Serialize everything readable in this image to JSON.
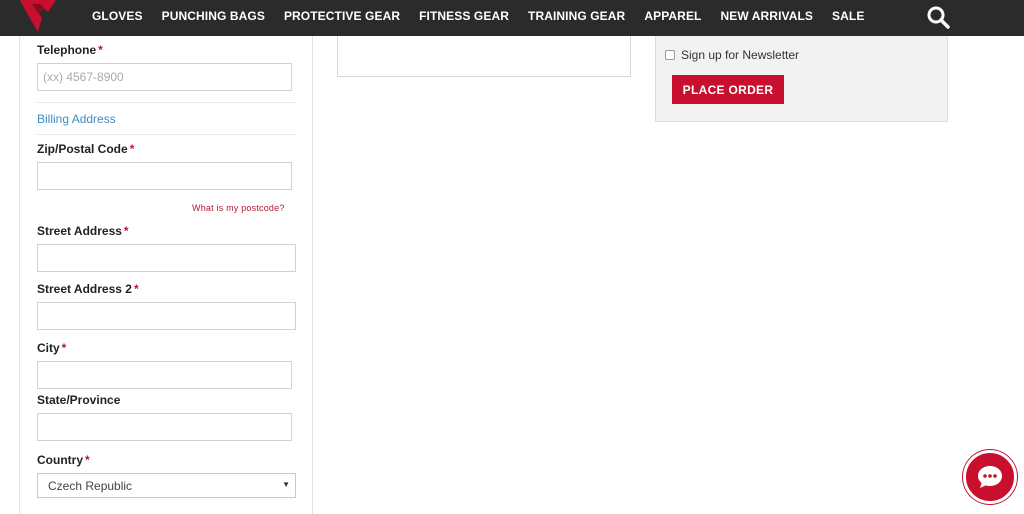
{
  "nav": {
    "items": [
      "GLOVES",
      "PUNCHING BAGS",
      "PROTECTIVE GEAR",
      "FITNESS GEAR",
      "TRAINING GEAR",
      "APPAREL",
      "NEW ARRIVALS",
      "SALE"
    ]
  },
  "icons": {
    "logo": "brand-logo-icon",
    "search": "search-icon",
    "chat": "chat-bubble-icon"
  },
  "colors": {
    "accent": "#c8102e",
    "topbar": "#2b2b2b",
    "link": "#3d8fc4"
  },
  "billing": {
    "telephone": {
      "label": "Telephone",
      "required": "*",
      "placeholder": "(xx) 4567-8900",
      "value": ""
    },
    "section_link": "Billing Address",
    "zip": {
      "label": "Zip/Postal Code",
      "required": "*",
      "value": ""
    },
    "postcode_help": "What is my postcode?",
    "street1": {
      "label": "Street Address",
      "required": "*",
      "value": ""
    },
    "street2": {
      "label": "Street Address 2",
      "required": "*",
      "value": ""
    },
    "city": {
      "label": "City",
      "required": "*",
      "value": ""
    },
    "state": {
      "label": "State/Province",
      "value": ""
    },
    "country": {
      "label": "Country",
      "required": "*",
      "selected": "Czech Republic",
      "caret": "▼"
    }
  },
  "summary": {
    "newsletter_label": "Sign up for Newsletter",
    "newsletter_checked": false,
    "place_order": "PLACE ORDER"
  }
}
